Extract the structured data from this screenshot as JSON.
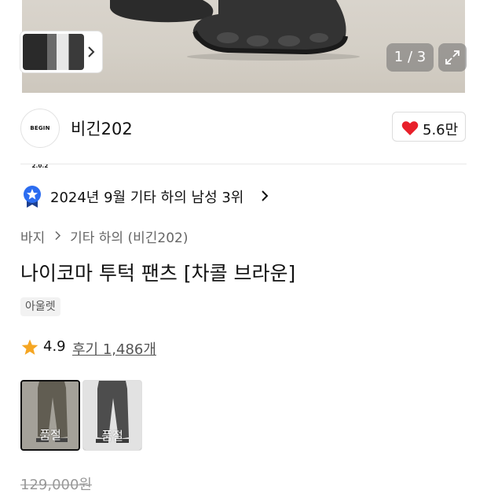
{
  "gallery": {
    "counter": "1 / 3",
    "thumb_arrow_icon": "chevron-right-icon",
    "expand_icon": "expand-icon"
  },
  "brand": {
    "logo_text": "BEGIN 2.0.2",
    "name": "비긴202",
    "likes": "5.6만",
    "like_icon": "heart-icon",
    "like_color": "#e8202a"
  },
  "ranking": {
    "text": "2024년 9월 기타 하의 남성 3위",
    "icon": "rank-badge-icon",
    "badge_color": "#2b6cf0"
  },
  "breadcrumb": {
    "category": "바지",
    "subcategory": "기타 하의 (비긴202)"
  },
  "product": {
    "title": "나이코마 투턱 팬츠 [차콜 브라운]",
    "tag": "아울렛",
    "rating": "4.9",
    "reviews": "후기 1,486개",
    "star_color": "#f5a623",
    "original_price": "129,000원"
  },
  "options": [
    {
      "label": "품절",
      "selected": true
    },
    {
      "label": "품절",
      "selected": false
    }
  ]
}
